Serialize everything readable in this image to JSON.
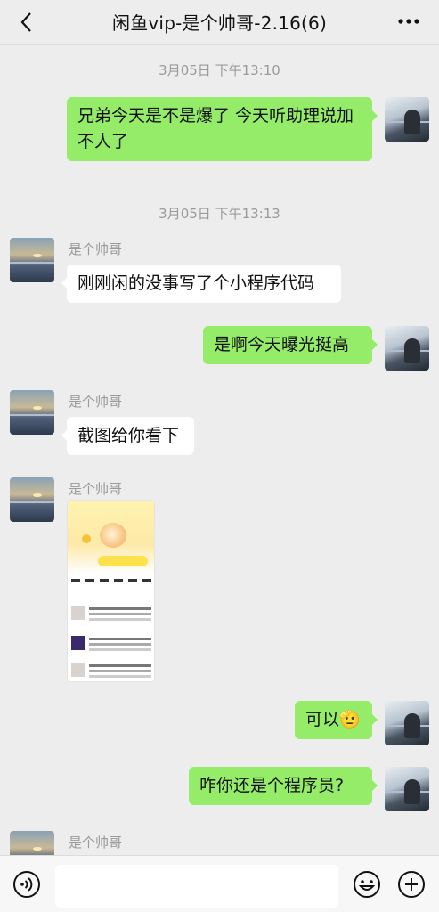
{
  "header": {
    "title": "闲鱼vip-是个帅哥-2.16(6)"
  },
  "colors": {
    "sent_bubble": "#95ec69",
    "received_bubble": "#ffffff",
    "background": "#ededed"
  },
  "messages": {
    "time_1": "3月05日 下午13:10",
    "msg_1": "兄弟今天是不是爆了  今天听助理说加不人了",
    "time_2": "3月05日 下午13:13",
    "sender_1": "是个帅哥",
    "msg_2": "刚刚闲的没事写了个小程序代码",
    "msg_3": "是啊今天曝光挺高",
    "sender_2": "是个帅哥",
    "msg_4": "截图给你看下",
    "sender_3": "是个帅哥",
    "msg_5": "可以",
    "msg_5_emoji": "🫡",
    "msg_6": "咋你还是个程序员?",
    "sender_4": "是个帅哥"
  },
  "input": {
    "placeholder": ""
  },
  "icons": [
    "back-icon",
    "more-icon",
    "voice-icon",
    "emoji-icon",
    "plus-icon"
  ]
}
